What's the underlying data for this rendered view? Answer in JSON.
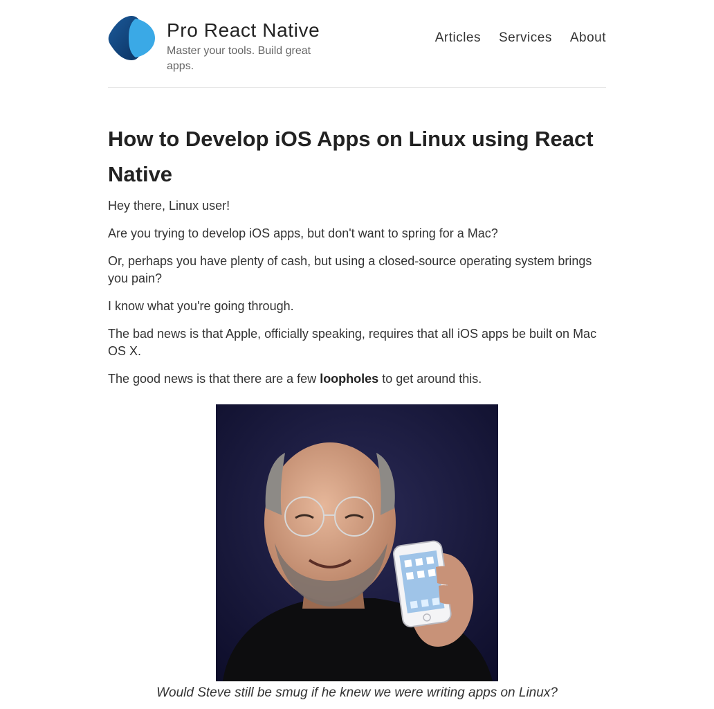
{
  "site": {
    "title": "Pro React Native",
    "tagline": "Master your tools. Build great apps."
  },
  "nav": {
    "items": [
      {
        "label": "Articles"
      },
      {
        "label": "Services"
      },
      {
        "label": "About"
      }
    ]
  },
  "article": {
    "title": "How to Develop iOS Apps on Linux using React Native",
    "paragraphs": [
      "Hey there, Linux user!",
      "Are you trying to develop iOS apps, but don't want to spring for a Mac?",
      "Or, perhaps you have plenty of cash, but using a closed-source operating system brings you pain?",
      "I know what you're going through.",
      "The bad news is that Apple, officially speaking, requires that all iOS apps be built on Mac OS X."
    ],
    "last_paragraph": {
      "before": "The good news is that there are a few ",
      "bold": "loopholes",
      "after": " to get around this."
    },
    "figure_caption": "Would Steve still be smug if he knew we were writing apps on Linux?"
  },
  "colors": {
    "logo_dark": "#0e3f73",
    "logo_light": "#3aa9e6",
    "photo_bg": "#12123a"
  }
}
